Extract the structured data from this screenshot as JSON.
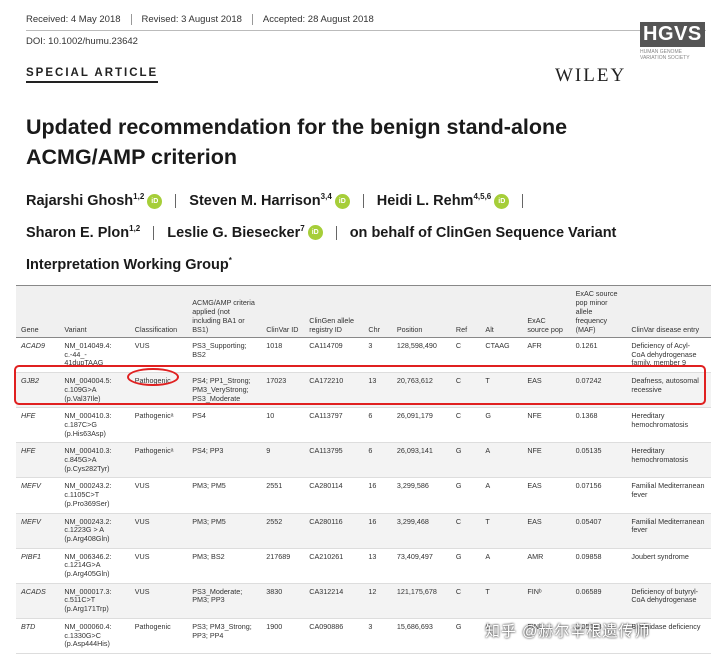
{
  "meta": {
    "received": "Received: 4 May 2018",
    "revised": "Revised: 3 August 2018",
    "accepted": "Accepted: 28 August 2018",
    "doi": "DOI: 10.1002/humu.23642"
  },
  "section_label": "SPECIAL ARTICLE",
  "publisher": "WILEY",
  "society_logo": {
    "abbr": "HGVS",
    "line1": "HUMAN GENOME",
    "line2": "VARIATION SOCIETY"
  },
  "title": {
    "line1": "Updated recommendation for the benign stand-alone",
    "line2": "ACMG/AMP criterion"
  },
  "authors": [
    {
      "name": "Rajarshi Ghosh",
      "aff": "1,2"
    },
    {
      "name": "Steven M. Harrison",
      "aff": "3,4"
    },
    {
      "name": "Heidi L. Rehm",
      "aff": "4,5,6"
    },
    {
      "name": "Sharon E. Plon",
      "aff": "1,2"
    },
    {
      "name": "Leslie G. Biesecker",
      "aff": "7"
    }
  ],
  "on_behalf_line1": "on behalf of ClinGen Sequence Variant",
  "on_behalf_line2": "Interpretation Working Group",
  "on_behalf_mark": "*",
  "orcid_label": "iD",
  "table": {
    "headers": [
      "Gene",
      "Variant",
      "Classification",
      "ACMG/AMP criteria applied (not including BA1 or BS1)",
      "ClinVar ID",
      "ClinGen allele registry ID",
      "Chr",
      "Position",
      "Ref",
      "Alt",
      "ExAC source pop",
      "ExAC source pop minor allele frequency (MAF)",
      "ClinVar disease entry"
    ],
    "rows": [
      {
        "gene": "ACAD9",
        "variant": [
          "NM_014049.4:",
          "c.-44_-",
          "41dupTAAG"
        ],
        "classification": "VUS",
        "criteria": [
          "PS3_Supporting;",
          "BS2"
        ],
        "clinvar": "1018",
        "allele": "CA114709",
        "chr": "3",
        "pos": "128,598,490",
        "ref": "C",
        "alt": "CTAAG",
        "pop": "AFR",
        "maf": "0.1261",
        "disease": [
          "Deficiency of Acyl-",
          "CoA dehydrogenase",
          "family, member 9"
        ]
      },
      {
        "gene": "GJB2",
        "variant": [
          "NM_004004.5:",
          "c.109G>A",
          "(p.Val37Ile)"
        ],
        "classification": "Pathogenic",
        "criteria": [
          "PS4; PP1_Strong;",
          "PM3_VeryStrong;",
          "PS3_Moderate"
        ],
        "clinvar": "17023",
        "allele": "CA172210",
        "chr": "13",
        "pos": "20,763,612",
        "ref": "C",
        "alt": "T",
        "pop": "EAS",
        "maf": "0.07242",
        "disease": [
          "Deafness, autosomal",
          "recessive"
        ]
      },
      {
        "gene": "HFE",
        "variant": [
          "NM_000410.3:",
          "c.187C>G",
          "(p.His63Asp)"
        ],
        "classification": "Pathogenicᵃ",
        "criteria": [
          "PS4"
        ],
        "clinvar": "10",
        "allele": "CA113797",
        "chr": "6",
        "pos": "26,091,179",
        "ref": "C",
        "alt": "G",
        "pop": "NFE",
        "maf": "0.1368",
        "disease": [
          "Hereditary",
          "hemochromatosis"
        ]
      },
      {
        "gene": "HFE",
        "variant": [
          "NM_000410.3:",
          "c.845G>A",
          "(p.Cys282Tyr)"
        ],
        "classification": "Pathogenicᵃ",
        "criteria": [
          "PS4; PP3"
        ],
        "clinvar": "9",
        "allele": "CA113795",
        "chr": "6",
        "pos": "26,093,141",
        "ref": "G",
        "alt": "A",
        "pop": "NFE",
        "maf": "0.05135",
        "disease": [
          "Hereditary",
          "hemochromatosis"
        ]
      },
      {
        "gene": "MEFV",
        "variant": [
          "NM_000243.2:",
          "c.1105C>T",
          "(p.Pro369Ser)"
        ],
        "classification": "VUS",
        "criteria": [
          "PM3; PM5"
        ],
        "clinvar": "2551",
        "allele": "CA280114",
        "chr": "16",
        "pos": "3,299,586",
        "ref": "G",
        "alt": "A",
        "pop": "EAS",
        "maf": "0.07156",
        "disease": [
          "Familial Mediterranean",
          "fever"
        ]
      },
      {
        "gene": "MEFV",
        "variant": [
          "NM_000243.2:",
          "c.1223G > A",
          "(p.Arg408Gln)"
        ],
        "classification": "VUS",
        "criteria": [
          "PM3; PM5"
        ],
        "clinvar": "2552",
        "allele": "CA280116",
        "chr": "16",
        "pos": "3,299,468",
        "ref": "C",
        "alt": "T",
        "pop": "EAS",
        "maf": "0.05407",
        "disease": [
          "Familial Mediterranean",
          "fever"
        ]
      },
      {
        "gene": "PIBF1",
        "variant": [
          "NM_006346.2:",
          "c.1214G>A",
          "(p.Arg405Gln)"
        ],
        "classification": "VUS",
        "criteria": [
          "PM3; BS2"
        ],
        "clinvar": "217689",
        "allele": "CA210261",
        "chr": "13",
        "pos": "73,409,497",
        "ref": "G",
        "alt": "A",
        "pop": "AMR",
        "maf": "0.09858",
        "disease": [
          "Joubert syndrome"
        ]
      },
      {
        "gene": "ACADS",
        "variant": [
          "NM_000017.3:",
          "c.511C>T",
          "(p.Arg171Trp)"
        ],
        "classification": "VUS",
        "criteria": [
          "PS3_Moderate;",
          "PM3; PP3"
        ],
        "clinvar": "3830",
        "allele": "CA312214",
        "chr": "12",
        "pos": "121,175,678",
        "ref": "C",
        "alt": "T",
        "pop": "FINᵇ",
        "maf": "0.06589",
        "disease": [
          "Deficiency of butyryl-",
          "CoA dehydrogenase"
        ]
      },
      {
        "gene": "BTD",
        "variant": [
          "NM_000060.4:",
          "c.1330G>C",
          "(p.Asp444His)"
        ],
        "classification": "Pathogenic",
        "criteria": [
          "PS3; PM3_Strong;",
          "PP3; PP4"
        ],
        "clinvar": "1900",
        "allele": "CA090886",
        "chr": "3",
        "pos": "15,686,693",
        "ref": "G",
        "alt": "C",
        "pop": "FINᵇ",
        "maf": "0.05398",
        "disease": [
          "Biotinidase deficiency"
        ]
      }
    ]
  },
  "watermark": "知乎 @赫尔辛根遗传师",
  "colors": {
    "highlight": "#e02020",
    "orcid": "#a6ce39"
  }
}
